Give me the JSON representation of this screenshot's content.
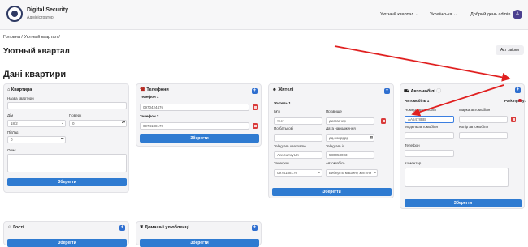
{
  "header": {
    "app_name": "Digital Security",
    "app_sub": "Адміністратор",
    "nav_1": "Уютный квартал",
    "nav_1_caret": "⌄",
    "nav_2": "Українська",
    "nav_2_caret": "⌄",
    "greeting": "Добрий день admin",
    "avatar_letter": "A"
  },
  "breadcrumb": "Головна / Уютный квартал /",
  "page_title": "Уютный квартал",
  "act_button": "Акт звірки",
  "section_title": "Дані квартири",
  "apartment": {
    "title": "Квартира",
    "name_label": "Назва квартири",
    "house_label": "Дім",
    "house_value": "18/2",
    "floor_label": "Поверх",
    "floor_value": "0",
    "entrance_label": "Під'їзд",
    "entrance_value": "0",
    "note_label": "Опис",
    "save": "Зберегти"
  },
  "phones": {
    "title": "Телефони",
    "phone1_label": "Телефон 1",
    "phone1_value": "0970424476",
    "phone2_label": "Телефон 2",
    "phone2_value": "0974188170",
    "save": "Зберегти"
  },
  "residents": {
    "title": "Жителі",
    "resident_label": "Житель 1",
    "name_label": "Ім'я",
    "name_value": "тест",
    "surname_label": "Прізвище",
    "surname_value": "дистагчер",
    "patronymic_label": "По батькові",
    "birth_label": "Дата народження",
    "birth_value": "дд.мм.рррр",
    "tg_user_label": "Telegram username",
    "tg_user_value": "AwscumryUK",
    "tg_id_label": "Telegram id",
    "tg_id_value": "580053003",
    "phone_label": "Телефон",
    "phone_value": "0974188170",
    "car_label": "Автомобіль",
    "car_value": "Виберіть машину жителя",
    "save": "Зберегти"
  },
  "cars": {
    "title": "Автомобілі",
    "info_icon": "ⓘ",
    "car_label": "Автомобіль 1",
    "parking_label": "ParkingPay:",
    "number_label": "Номер автомобіля",
    "number_value": "АА5478ВВ",
    "brand_label": "Марка автомобіля",
    "model_label": "Модель автомобіля",
    "color_label": "Колір автомобіля",
    "phone_label": "Телефон",
    "comment_label": "Коментар",
    "save": "Зберегти"
  },
  "guests": {
    "title": "Гості",
    "save": "Зберегти"
  },
  "pets": {
    "title": "Домашні улюбленці",
    "save": "Зберегти"
  },
  "plus_label": "+",
  "colors": {
    "primary": "#2f7bd1",
    "danger": "#d93b3b",
    "arrow": "#e02020"
  }
}
